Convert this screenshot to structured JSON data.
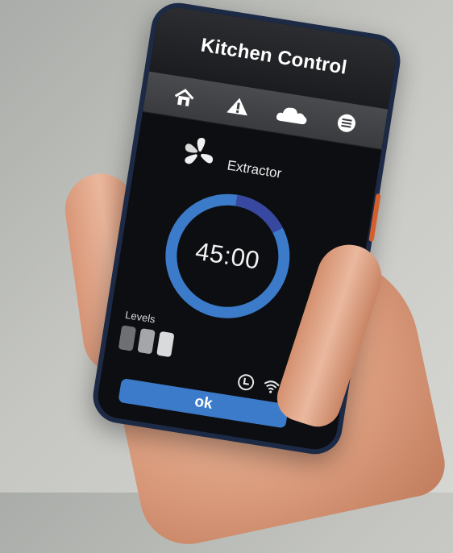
{
  "app": {
    "title": "Kitchen Control"
  },
  "nav": {
    "items": [
      {
        "icon": "home-icon"
      },
      {
        "icon": "warning-icon"
      },
      {
        "icon": "cloud-icon"
      },
      {
        "icon": "menu-icon"
      }
    ]
  },
  "device": {
    "name": "Extractor",
    "icon": "fan-icon"
  },
  "timer": {
    "display": "45:00",
    "progress": 0.15
  },
  "levels": {
    "label": "Levels",
    "items": [
      {
        "color": "#6f7073"
      },
      {
        "color": "#a5a6a9"
      },
      {
        "color": "#d9dadc"
      }
    ]
  },
  "status": {
    "icons": [
      "clock-icon",
      "wifi-icon"
    ]
  },
  "actions": {
    "ok_label": "ok"
  },
  "colors": {
    "ring": "#3b7bc9",
    "ring_progress": "#3848a0",
    "accent": "#3b7bc9"
  }
}
